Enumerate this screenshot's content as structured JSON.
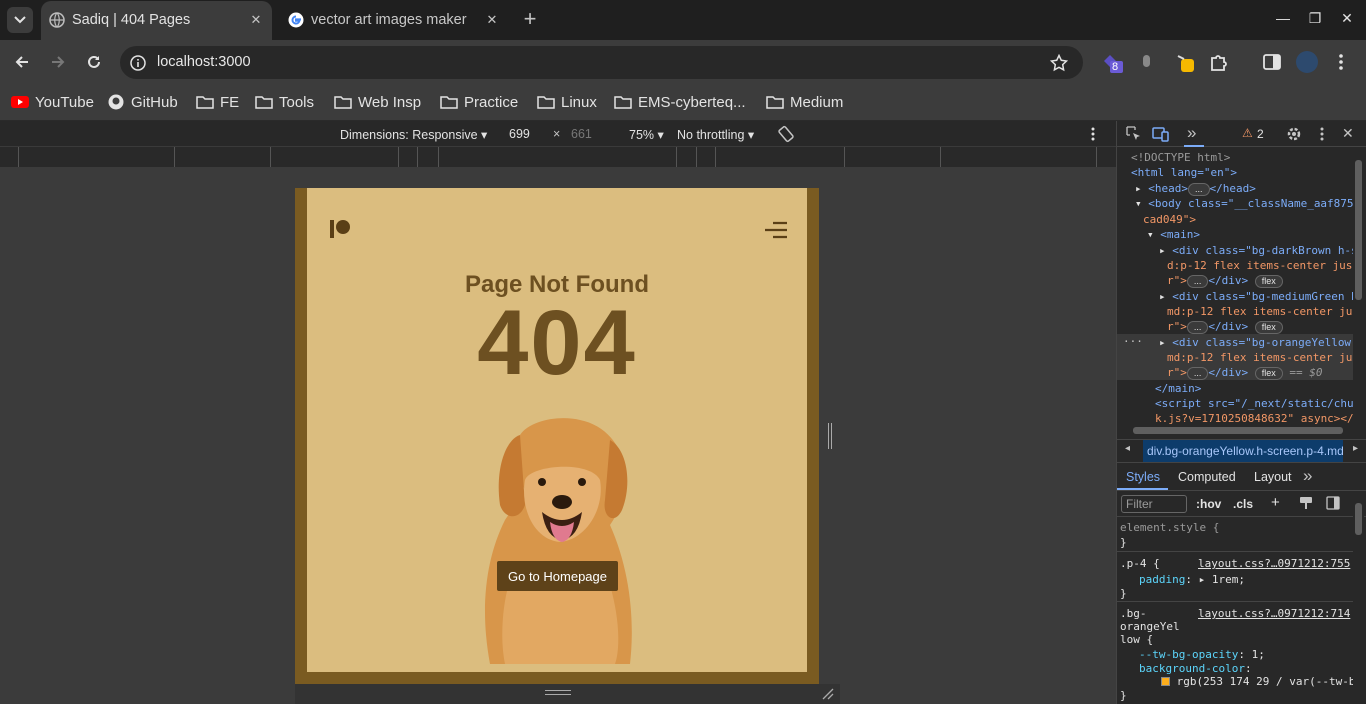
{
  "tabs": [
    {
      "title": "Sadiq | 404 Pages",
      "active": true
    },
    {
      "title": "vector art images maker",
      "active": false
    }
  ],
  "omnibox": {
    "url": "localhost:3000"
  },
  "extensions": {
    "badge_count": "8"
  },
  "bookmarks": [
    "YouTube",
    "GitHub",
    "FE",
    "Tools",
    "Web Insp",
    "Practice",
    "Linux",
    "EMS-cyberteq...",
    "Medium"
  ],
  "device_toolbar": {
    "dimensions_label": "Dimensions: Responsive",
    "width": "699",
    "times": "×",
    "height": "661",
    "zoom": "75%",
    "throttling": "No throttling"
  },
  "page": {
    "heading": "Page Not Found",
    "code": "404",
    "button": "Go to Homepage"
  },
  "devtools": {
    "warnings": "2",
    "dom_lines": [
      "<!DOCTYPE html>",
      "<html lang=\"en\">",
      "<head>",
      "</head>",
      "<body class=\"__className_aaf875",
      "cad049\">",
      "<main>",
      "<div class=\"bg-darkBrown h-s",
      "d:p-12 flex items-center jus",
      "r\">",
      "</div>",
      "<div class=\"bg-mediumGreen h",
      "md:p-12 flex items-center ju",
      "<div class=\"bg-orangeYellow",
      "== $0",
      "</main>",
      "<script src=\"/_next/static/chu",
      "k.js?v=1710250848632\" async></",
      "flex",
      "..."
    ],
    "breadcrumb": "div.bg-orangeYellow.h-screen.p-4.md",
    "style_tabs": [
      "Styles",
      "Computed",
      "Layout"
    ],
    "filter_placeholder": "Filter",
    "hov": ":hov",
    "cls": ".cls",
    "rules": {
      "element_style": "element.style {",
      "close": "}",
      "p4_selector": ".p-4 {",
      "p4_link": "layout.css?…0971212:755",
      "p4_prop": "padding",
      "p4_val": "1rem;",
      "bg_selector_1": ".bg-",
      "bg_selector_2": "orangeYel",
      "bg_selector_3": "low {",
      "bg_link": "layout.css?…0971212:714",
      "bg_prop1": "--tw-bg-opacity",
      "bg_val1": "1;",
      "bg_prop2": "background-color",
      "bg_val2": "rgb(253 174 29 / var(--tw-b"
    }
  },
  "colors": {
    "page_bg": "#dbbd7f",
    "frame": "#7a5b21",
    "text_brown": "#6d5021",
    "button_bg": "#5e4219",
    "accent_blue": "#7cacf8"
  }
}
